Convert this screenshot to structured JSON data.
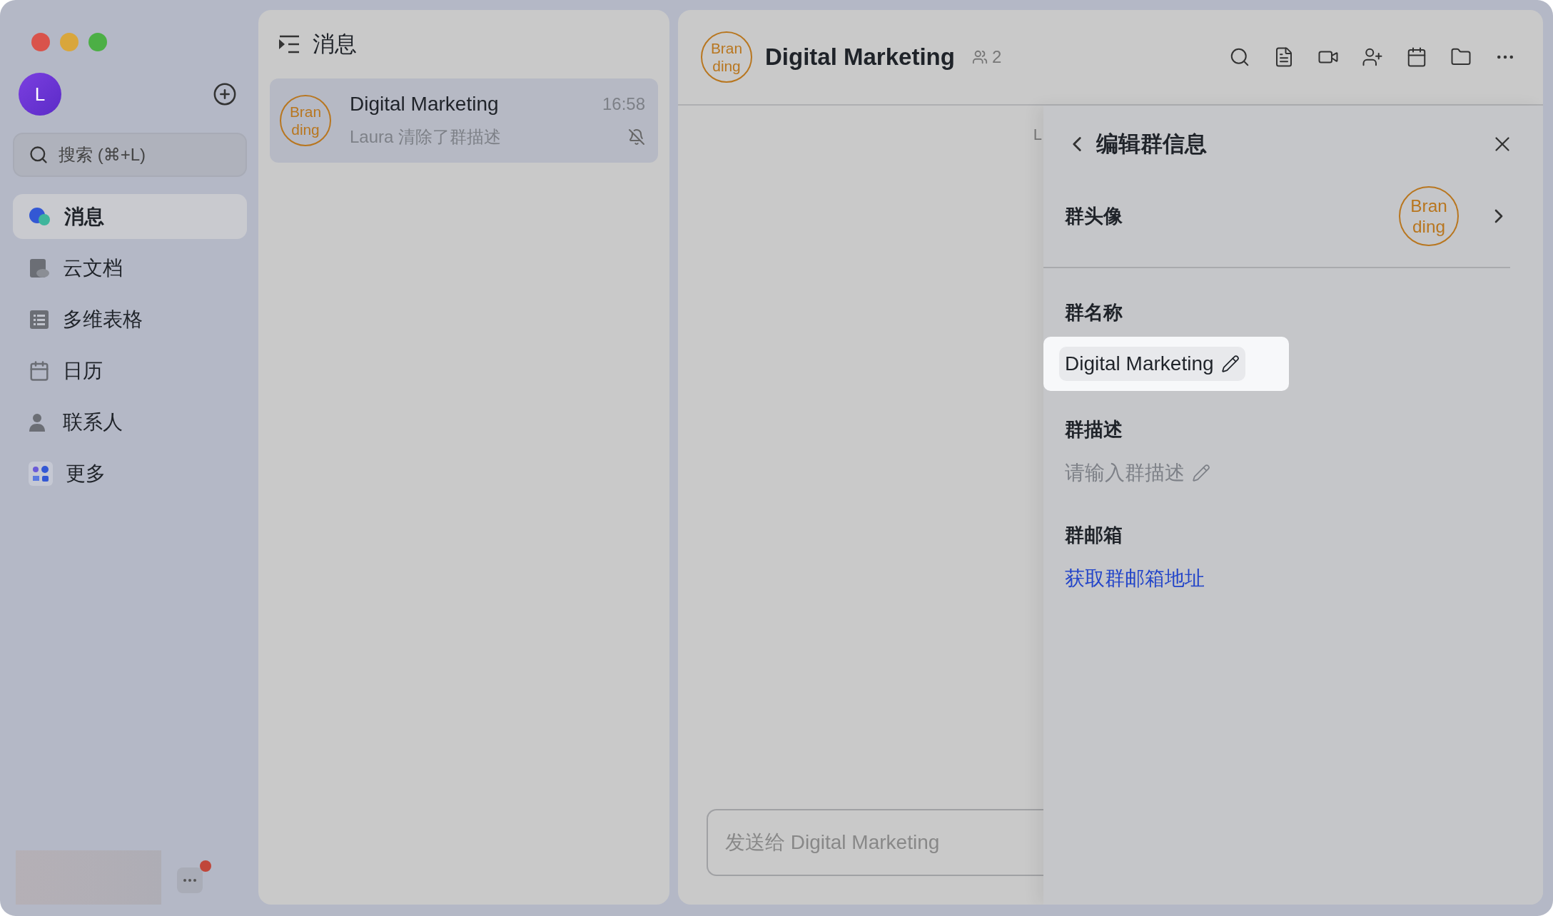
{
  "sidebar": {
    "avatar_initial": "L",
    "search": {
      "placeholder": "搜索 (⌘+L)"
    },
    "items": [
      {
        "label": "消息",
        "kind": "chat",
        "selected": true
      },
      {
        "label": "云文档",
        "kind": "docs",
        "selected": false
      },
      {
        "label": "多维表格",
        "kind": "table",
        "selected": false
      },
      {
        "label": "日历",
        "kind": "calendar",
        "selected": false
      },
      {
        "label": "联系人",
        "kind": "contacts",
        "selected": false
      },
      {
        "label": "更多",
        "kind": "more",
        "selected": false
      }
    ],
    "more_button": {
      "has_notification": true
    }
  },
  "chat_list": {
    "title": "消息",
    "chats": [
      {
        "avatar": [
          "Bran",
          "ding"
        ],
        "name": "Digital Marketing",
        "time": "16:58",
        "preview": "Laura 清除了群描述",
        "muted": true,
        "selected": true
      }
    ]
  },
  "chat": {
    "avatar": [
      "Bran",
      "ding"
    ],
    "title": "Digital Marketing",
    "member_count": "2",
    "toolbar": [
      {
        "kind": "search"
      },
      {
        "kind": "doc"
      },
      {
        "kind": "video"
      },
      {
        "kind": "add-member"
      },
      {
        "kind": "calendar"
      },
      {
        "kind": "folder"
      },
      {
        "kind": "more"
      }
    ],
    "message_fragment": "L",
    "composer": {
      "placeholder": "发送给 Digital Marketing"
    }
  },
  "edit_panel": {
    "title": "编辑群信息",
    "avatar_row": {
      "label": "群头像",
      "avatar": [
        "Bran",
        "ding"
      ]
    },
    "name_section": {
      "label": "群名称",
      "value": "Digital Marketing",
      "highlighted": true
    },
    "description_section": {
      "label": "群描述",
      "placeholder": "请输入群描述"
    },
    "mailbox_section": {
      "label": "群邮箱",
      "link": "获取群邮箱地址"
    }
  }
}
